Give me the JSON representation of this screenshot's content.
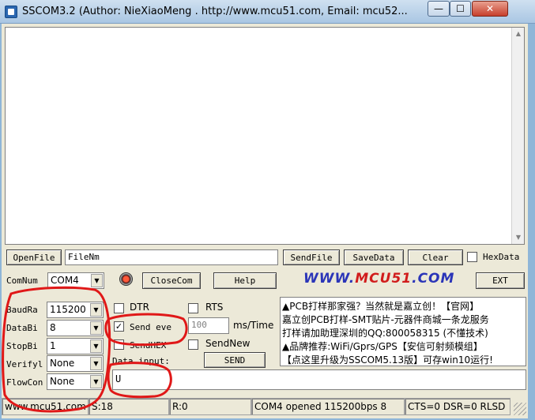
{
  "window": {
    "title": "SSCOM3.2 (Author: NieXiaoMeng .  http://www.mcu51.com,  Email: mcu52...",
    "min_glyph": "—",
    "max_glyph": "☐",
    "close_glyph": "✕"
  },
  "toolbar": {
    "openfile_label": "OpenFile",
    "filename_value": "FileNm",
    "sendfile_label": "SendFile",
    "savedata_label": "SaveData",
    "clear_label": "Clear",
    "hexdata_label": "HexData",
    "comnum_label": "ComNum",
    "comnum_value": "COM4",
    "closecom_label": "CloseCom",
    "help_label": "Help",
    "ext_label": "EXT",
    "logo_part1": "WWW.",
    "logo_part2": "MCU51",
    "logo_part3": ".COM"
  },
  "settings": {
    "baudrate_label": "BaudRa",
    "baudrate_value": "115200",
    "databits_label": "DataBi",
    "databits_value": "8",
    "stopbits_label": "StopBi",
    "stopbits_value": "1",
    "verify_label": "Verifyl",
    "verify_value": "None",
    "flowcontrol_label": "FlowCon",
    "flowcontrol_value": "None"
  },
  "options": {
    "dtr_label": "DTR",
    "rts_label": "RTS",
    "send_every_label": "Send eve",
    "send_every_checked": true,
    "interval_value": "100",
    "interval_unit": "ms/Time",
    "sendhex_label": "SendHEX",
    "sendnew_label": "SendNew",
    "data_input_label": "Data input:",
    "send_label": "SEND",
    "send_data_value": "U"
  },
  "ads": [
    "▲PCB打样那家强？当然就是嘉立创！【官网】",
    "嘉立创PCB打样-SMT贴片-元器件商城一条龙服务",
    "打样请加助理深圳的QQ:800058315 (不懂技术)",
    "▲品牌推荐:WiFi/Gprs/GPS【安信可射频模组】",
    "【点这里升级为SSCOM5.13版】可存win10运行!"
  ],
  "statusbar": {
    "website": "www.mcu51.com",
    "sent": "S:18",
    "received": "R:0",
    "port_status": "COM4 opened 115200bps  8",
    "signals": "CTS=0 DSR=0 RLSD"
  },
  "colors": {
    "annotation": "#e01818",
    "logo_blue": "#2b35b8",
    "logo_red": "#d11c1c"
  }
}
